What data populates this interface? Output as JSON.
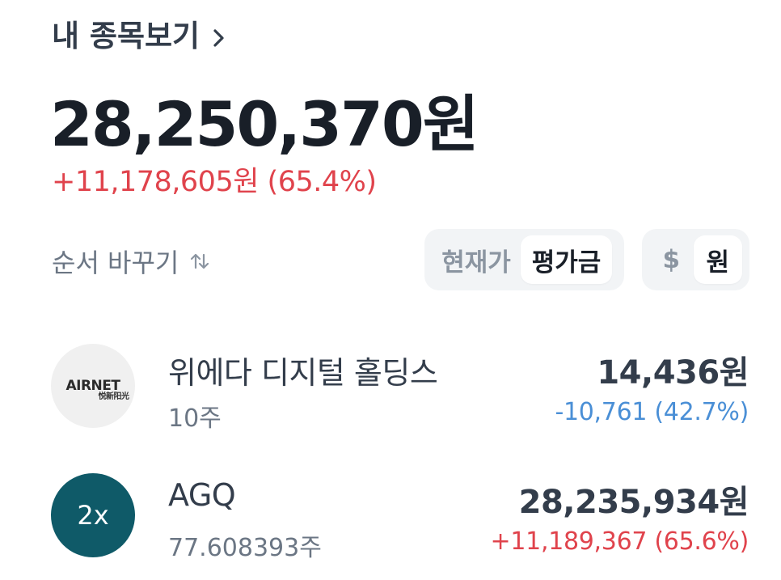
{
  "header": {
    "title": "내 종목보기",
    "chevron_icon": "chevron-right-icon"
  },
  "summary": {
    "total_value": "28,250,370원",
    "total_change": "+11,178,605원 (65.4%)",
    "change_color": "#e0434c"
  },
  "controls": {
    "sort_label": "순서 바꾸기",
    "sort_icon": "sort-arrows-icon",
    "price_toggle": {
      "options": [
        "현재가",
        "평가금"
      ],
      "selected": "평가금"
    },
    "currency_toggle": {
      "options": [
        "$",
        "원"
      ],
      "selected": "원"
    }
  },
  "holdings": [
    {
      "logo_text": "AIRNET",
      "logo_sub": "悦新阳光",
      "name": "위에다 디지털 홀딩스",
      "quantity": "10주",
      "value": "14,436원",
      "change": "-10,761 (42.7%)",
      "direction": "down",
      "color": "#4a8fd6"
    },
    {
      "logo_text": "2x",
      "name": "AGQ",
      "quantity": "77.608393주",
      "value": "28,235,934원",
      "change": "+11,189,367 (65.6%)",
      "direction": "up",
      "color": "#e0434c",
      "logo_bg": "#0f5a68"
    }
  ]
}
